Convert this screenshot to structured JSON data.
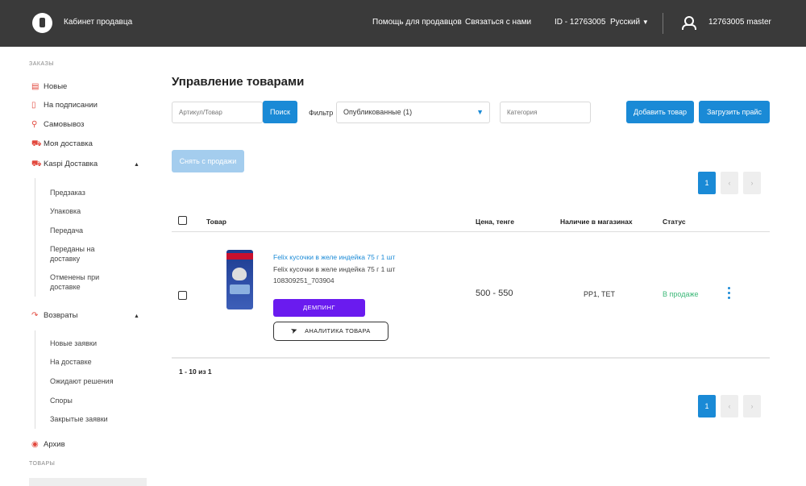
{
  "header": {
    "brand": "Кабинет продавца",
    "links": [
      "Помощь для продавцов",
      "Связаться с нами"
    ],
    "seller_id": "ID - 12763005",
    "language": "Русский",
    "username": "12763005 master"
  },
  "sidebar": {
    "orders_title": "ЗАКАЗЫ",
    "items": [
      {
        "label": "Новые",
        "icon": "order-icon"
      },
      {
        "label": "На подписании",
        "icon": "document-icon"
      },
      {
        "label": "Самовывоз",
        "icon": "pin-icon"
      },
      {
        "label": "Моя доставка",
        "icon": "truck-icon"
      },
      {
        "label": "Kaspi Доставка",
        "icon": "truck-icon"
      }
    ],
    "kaspi_delivery_sub": [
      "Предзаказ",
      "Упаковка",
      "Передача",
      "Переданы на доставку",
      "Отменены при доставке"
    ],
    "returns": {
      "label": "Возвраты",
      "icon": "return-icon"
    },
    "returns_sub": [
      "Новые заявки",
      "На доставке",
      "Ожидают решения",
      "Споры",
      "Закрытые заявки"
    ],
    "archive": {
      "label": "Архив",
      "icon": "archive-icon"
    },
    "goods_title": "ТОВАРЫ"
  },
  "main": {
    "title": "Управление товарами",
    "search_placeholder": "Артикул/Товар",
    "search_button": "Поиск",
    "filter_label": "Фильтр",
    "filter_value": "Опубликованные (1)",
    "category_placeholder": "Категория",
    "add_product": "Добавить товар",
    "upload_price": "Загрузить прайс",
    "remove_from_sale": "Снять с продажи",
    "pagination": {
      "page": "1",
      "prev": "‹",
      "next": "›"
    },
    "columns": [
      "Товар",
      "Цена, тенге",
      "Наличие в магазинах",
      "Статус"
    ],
    "product": {
      "name_link": "Felix кусочки в желе индейка 75 г 1 шт",
      "name": "Felix кусочки в желе индейка 75 г 1 шт",
      "sku": "108309251_703904",
      "dumping_button": "ДЕМПИНГ",
      "analytics_button": "АНАЛИТИКА ТОВАРА",
      "price": "500 - 550",
      "stores": "PP1, ТЕТ",
      "status": "В продаже"
    },
    "count_text": "1 - 10 из 1"
  },
  "colors": {
    "accent": "#1a8ad6",
    "header_bg": "#3a3a3a",
    "dumping": "#6a1bef",
    "status": "#3cb878",
    "icon_red": "#e2483d"
  }
}
